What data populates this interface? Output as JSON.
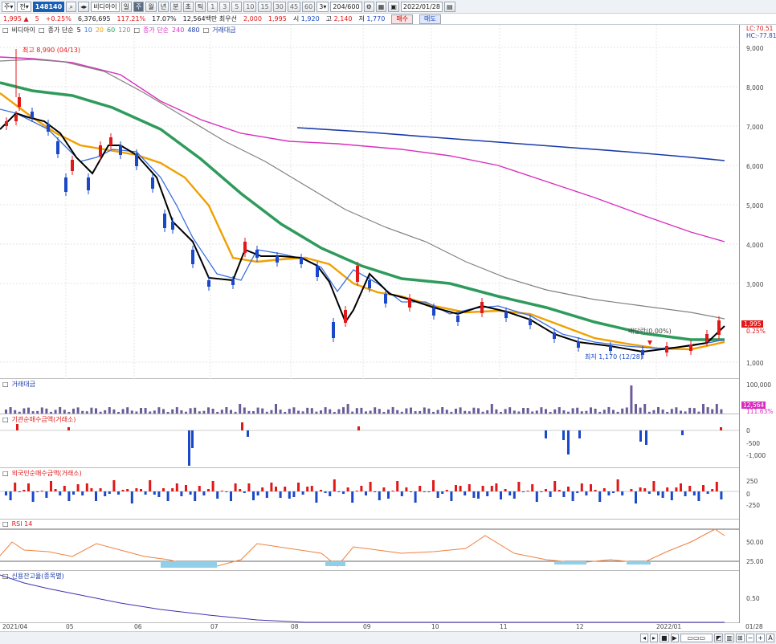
{
  "toolbar": {
    "type_label": "주",
    "market_label": "전",
    "code": "148140",
    "name": "비디아이",
    "period_buttons": [
      "일",
      "주",
      "월",
      "년",
      "분",
      "초",
      "틱"
    ],
    "minute_buttons": [
      "1",
      "3",
      "5",
      "10",
      "15",
      "30",
      "45",
      "60"
    ],
    "interval_value": "3",
    "count": "204/600",
    "date": "2022/01/28"
  },
  "quote": {
    "price": "1,995",
    "change": "5",
    "change_pct": "+0.25%",
    "volume": "6,376,695",
    "volume_ratio": "117.21%",
    "turnover": "17.07%",
    "amount": "12,564백만",
    "best_bid_label": "최우선",
    "best_bid": "2,000",
    "best_ask": "1,995",
    "open_label": "시",
    "open": "1,920",
    "high_label": "고",
    "high": "2,140",
    "low_label": "저",
    "low": "1,770",
    "buy_label": "매수",
    "sell_label": "매도"
  },
  "price_pane": {
    "name": "비디아이",
    "ma_label": "종가 단순",
    "ma_periods": [
      "5",
      "10",
      "20",
      "60",
      "120"
    ],
    "ma2_label": "종가 단순",
    "ma2_periods": [
      "240",
      "480"
    ],
    "volume_legend": "거래대금",
    "lc_label": "LC:70.51",
    "hc_label": "HC:-77.81",
    "high_annotation": "최고 8,990 (04/13)",
    "low_annotation": "최저 1,170 (12/28)",
    "dividend_annotation": "배당락(0.00%)",
    "current_price_tag": "1,995",
    "current_pct_tag": "0.25%",
    "y_ticks": [
      "9,000",
      "8,000",
      "7,000",
      "6,000",
      "5,000",
      "4,000",
      "3,000",
      "1,000"
    ]
  },
  "volume_pane": {
    "title": "거래대금",
    "y_ticks": [
      "100,000"
    ],
    "tag_value": "12,564",
    "tag_pct": "111.63%"
  },
  "inst_pane": {
    "title": "기관순매수금액(거래소)",
    "y_ticks": [
      "0",
      "-500",
      "-1,000"
    ]
  },
  "foreign_pane": {
    "title": "외국인순매수금액(거래소)",
    "y_ticks": [
      "250",
      "0",
      "-250"
    ]
  },
  "rsi_pane": {
    "title": "RSI 14",
    "y_ticks": [
      "50.00",
      "25.00"
    ]
  },
  "credit_pane": {
    "title": "신용잔고율(종목별)",
    "y_ticks": [
      "0.50"
    ]
  },
  "x_axis": {
    "labels": [
      "2021/04",
      "05",
      "06",
      "07",
      "08",
      "09",
      "10",
      "11",
      "12",
      "2022/01"
    ],
    "right_label": "01/28"
  },
  "colors": {
    "up": "#e01818",
    "down": "#1a48c8",
    "ma5": "#000000",
    "ma10": "#3a6fe0",
    "ma20": "#f0a000",
    "ma60": "#2e9b5c",
    "ma120": "#808080",
    "ma240": "#d82fbf",
    "ma480": "#1a3aa8"
  }
}
